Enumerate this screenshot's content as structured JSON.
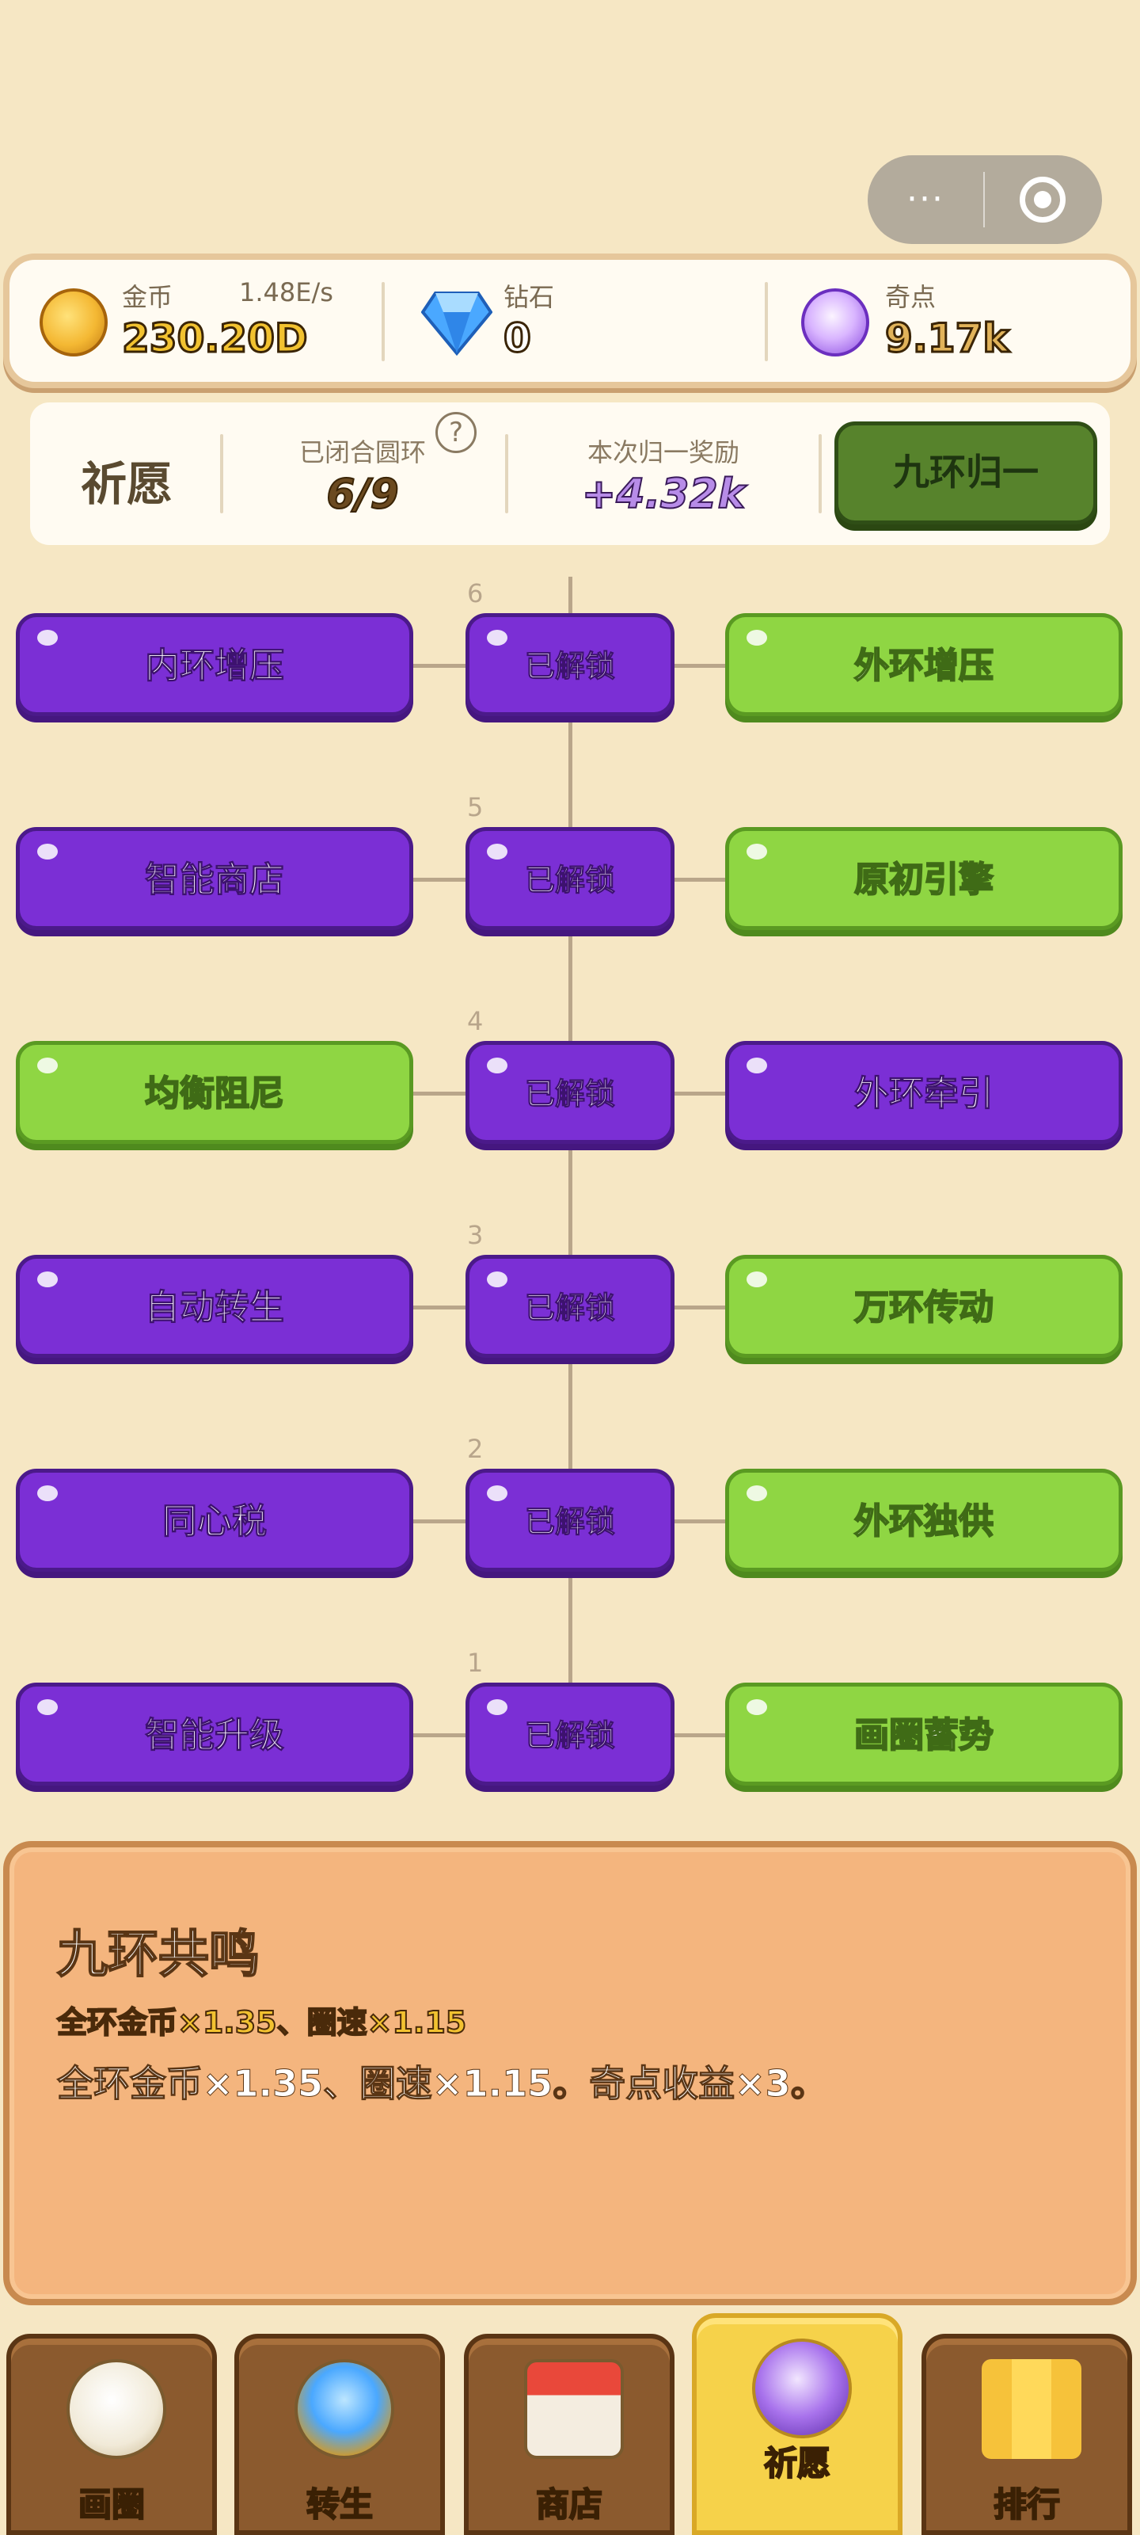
{
  "capsule": {
    "more_icon": "···",
    "target_icon": "target-icon"
  },
  "resources": {
    "gold": {
      "label": "金币",
      "rate": "1.48E/s",
      "value": "230.20D",
      "icon": "gold-coin-icon"
    },
    "diamond": {
      "label": "钻石",
      "value": "0",
      "icon": "diamond-icon"
    },
    "qidian": {
      "label": "奇点",
      "value": "9.17k",
      "icon": "orb-icon"
    }
  },
  "wish": {
    "title": "祈愿",
    "closed_label": "已闭合圆环",
    "closed_value": "6/9",
    "reward_label": "本次归一奖励",
    "reward_value": "+4.32k",
    "help": "?",
    "action_label": "九环归一"
  },
  "tree": {
    "tiers": [
      {
        "num": "6",
        "left": "内环增压",
        "center": "已解锁",
        "right": "外环增压",
        "left_color": "purple",
        "right_color": "green"
      },
      {
        "num": "5",
        "left": "智能商店",
        "center": "已解锁",
        "right": "原初引擎",
        "left_color": "purple",
        "right_color": "green"
      },
      {
        "num": "4",
        "left": "均衡阻尼",
        "center": "已解锁",
        "right": "外环牵引",
        "left_color": "green",
        "right_color": "purple"
      },
      {
        "num": "3",
        "left": "自动转生",
        "center": "已解锁",
        "right": "万环传动",
        "left_color": "purple",
        "right_color": "green"
      },
      {
        "num": "2",
        "left": "同心税",
        "center": "已解锁",
        "right": "外环独供",
        "left_color": "purple",
        "right_color": "green"
      },
      {
        "num": "1",
        "left": "智能升级",
        "center": "已解锁",
        "right": "画圈蓄势",
        "left_color": "purple",
        "right_color": "green"
      }
    ]
  },
  "description": {
    "title": "九环共鸣",
    "subtitle": "全环金币×1.35、圈速×1.15",
    "body": "全环金币×1.35、圈速×1.15。奇点收益×3。"
  },
  "nav": {
    "tabs": [
      {
        "label": "画圈",
        "icon": "pencil-circle-icon",
        "active": false
      },
      {
        "label": "转生",
        "icon": "diamond-ring-icon",
        "active": false
      },
      {
        "label": "商店",
        "icon": "shop-icon",
        "active": false
      },
      {
        "label": "祈愿",
        "icon": "wish-orb-icon",
        "active": true
      },
      {
        "label": "排行",
        "icon": "podium-icon",
        "active": false
      }
    ]
  },
  "colors": {
    "background": "#f6e7c4",
    "purple": "#7b2fd5",
    "green": "#8fd643",
    "action_green": "#57832c",
    "panel_orange": "#f4b57e",
    "nav_brown": "#8b5a2e",
    "nav_active": "#f6d24a"
  }
}
